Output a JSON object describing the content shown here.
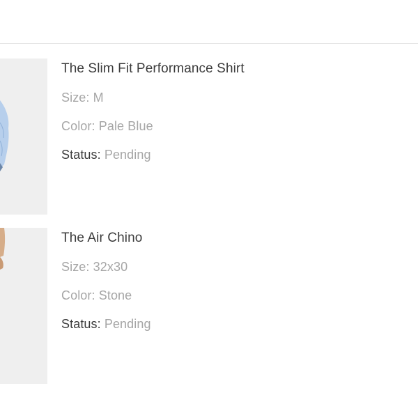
{
  "order_items": [
    {
      "name": "The Slim Fit Performance Shirt",
      "size_label": "Size:",
      "size_value": "M",
      "color_label": "Color:",
      "color_value": "Pale Blue",
      "status_label": "Status:",
      "status_value": "Pending",
      "image_icon": "shirt-image"
    },
    {
      "name": "The Air Chino",
      "size_label": "Size:",
      "size_value": "32x30",
      "color_label": "Color:",
      "color_value": "Stone",
      "status_label": "Status:",
      "status_value": "Pending",
      "image_icon": "pants-image"
    }
  ],
  "colors": {
    "text_primary": "#3b3b3b",
    "text_secondary": "#a6a6a6",
    "divider": "#e4e4e4",
    "thumb_bg": "#efefef",
    "shirt_blue": "#a9c6e8",
    "chino_stone": "#d9b08c"
  }
}
